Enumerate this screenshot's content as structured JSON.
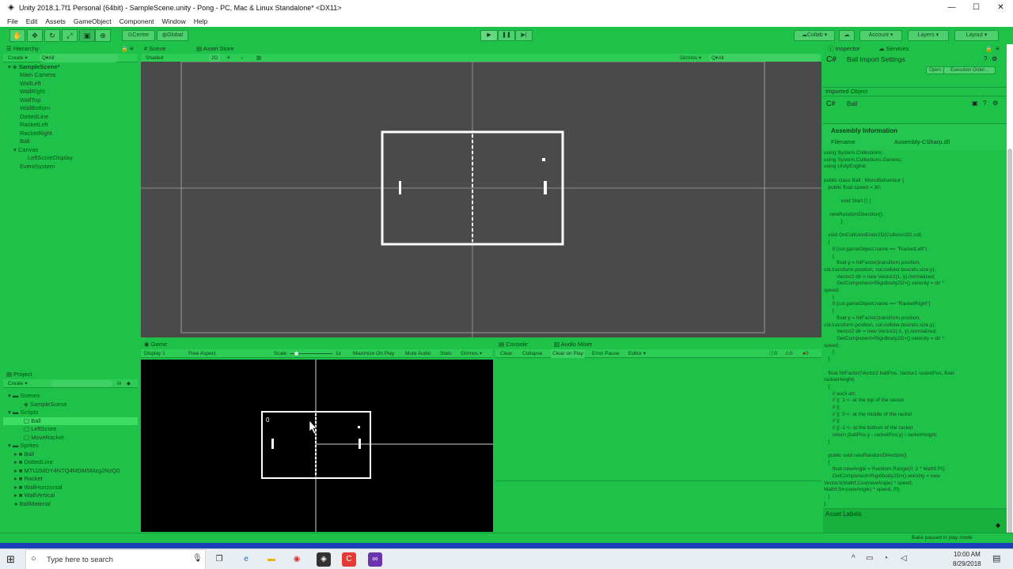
{
  "window": {
    "title": "Unity 2018.1.7f1 Personal (64bit) - SampleScene.unity - Pong - PC, Mac & Linux Standalone* <DX11>",
    "controls": [
      "—",
      "☐",
      "✕"
    ]
  },
  "menu": [
    "File",
    "Edit",
    "Assets",
    "GameObject",
    "Component",
    "Window",
    "Help"
  ],
  "toolbar": {
    "pivot": "Center",
    "space": "Global",
    "collab": "Collab ▾",
    "account": "Account ▾",
    "layers": "Layers ▾",
    "layout": "Layout ▾"
  },
  "hierarchy": {
    "tab": "Hierarchy",
    "create": "Create ▾",
    "search": "Q▾All",
    "scene": "SampleScene*",
    "items": [
      "Main Camera",
      "WallLeft",
      "WallRight",
      "WallTop",
      "WallBottom",
      "DottedLine",
      "RacketLeft",
      "RacketRight",
      "Ball",
      "Canvas",
      "LeftScoreDisplay",
      "EventSystem"
    ]
  },
  "scene": {
    "tabs": [
      "Scene",
      "Asset Store"
    ],
    "shading": "Shaded",
    "mode2d": "2D",
    "gizmos": "Gizmos ▾",
    "search": "Q▾All"
  },
  "game": {
    "tab": "Game",
    "display": "Display 1",
    "aspect": "Free Aspect",
    "scale_label": "Scale",
    "scale_value": "1x",
    "options": [
      "Maximize On Play",
      "Mute Audio",
      "Stats",
      "Gizmos ▾"
    ],
    "score": "0"
  },
  "console": {
    "tabs": [
      "Console",
      "Audio Mixer"
    ],
    "buttons": [
      "Clear",
      "Collapse",
      "Clear on Play",
      "Error Pause",
      "Editor ▾"
    ],
    "counts": [
      "0",
      "0",
      "0"
    ]
  },
  "project": {
    "tab": "Project",
    "create": "Create ▾",
    "items": [
      {
        "label": "Scenes",
        "indent": 0
      },
      {
        "label": "SampleScene",
        "indent": 1
      },
      {
        "label": "Scripts",
        "indent": 0
      },
      {
        "label": "Ball",
        "indent": 1
      },
      {
        "label": "LeftScore",
        "indent": 1
      },
      {
        "label": "MoveRacket",
        "indent": 1
      },
      {
        "label": "Sprites",
        "indent": 0
      },
      {
        "label": "Ball",
        "indent": 1
      },
      {
        "label": "DottedLine",
        "indent": 1
      },
      {
        "label": "MTU2MDY4NTQ4MDM5Mzg2NzQ0",
        "indent": 1
      },
      {
        "label": "Racket",
        "indent": 1
      },
      {
        "label": "WallHorizontal",
        "indent": 1
      },
      {
        "label": "WallVertical",
        "indent": 1
      },
      {
        "label": "BallMaterial",
        "indent": 0
      }
    ]
  },
  "inspector": {
    "tabs": [
      "Inspector",
      "Services"
    ],
    "title": "Ball Import Settings",
    "open": "Open...",
    "execution_order": "Execution Order...",
    "imported_object": "Imported Object",
    "object_name": "Ball",
    "assembly_header": "Assembly Information",
    "filename_label": "Filename",
    "filename_value": "Assembly-CSharp.dll",
    "code": "using System.Collections;\nusing System.Collections.Generic;\nusing UnityEngine;\n\npublic class Ball : MonoBehaviour {\n   public float speed = 30;\n\n            void Start () {\n\n    newRandomDirection();\n            }\n\n   void OnCollisionEnter2D(Collision2D col)\n   {\n      if (col.gameObject.name == \"RacketLeft\")\n      {\n         float y = hitFactor(transform.position,\ncol.transform.position, col.collider.bounds.size.y);\n         Vector2 dir = new Vector2(1, y).normalized;\n         GetComponent<Rigidbody2D>().velocity = dir *\nspeed;\n      }\n      if (col.gameObject.name == \"RacketRight\")\n      {\n         float y = hitFactor(transform.position,\ncol.transform.position, col.collider.bounds.size.y);\n         Vector2 dir = new Vector2(-1, y).normalized;\n         GetComponent<Rigidbody2D>().velocity = dir *\nspeed;\n      }\n   }\n\n   float hitFactor(Vector2 ballPos, Vector2 racketPos, float\nracketHeight)\n   {\n      // ascii art:\n      // ||  1 <- at the top of the racket\n      // ||\n      // ||  0 <- at the middle of the racket\n      // ||\n      // || -1 <- at the bottom of the racket\n      return (ballPos.y - racketPos.y) / racketHeight;\n   }\n\n   public void newRandomDirection()\n   {\n      float newAngle = Random.Range(0, 2 * Mathf.PI);\n      GetComponent<Rigidbody2D>().velocity = new\nVector3(Mathf.Cos(newAngle) * speed,\nMathf.Sin(newAngle) * speed, 0f);\n   }\n}",
    "asset_labels": "Asset Labels"
  },
  "statusbar": {
    "message": "Bake paused in play mode"
  },
  "taskbar": {
    "search_placeholder": "Type here to search",
    "time": "10:00 AM",
    "date": "8/29/2018"
  },
  "colors": {
    "panel_green": "#1fc248",
    "scene_bg": "#4a4a4a",
    "game_bg": "#000000"
  }
}
